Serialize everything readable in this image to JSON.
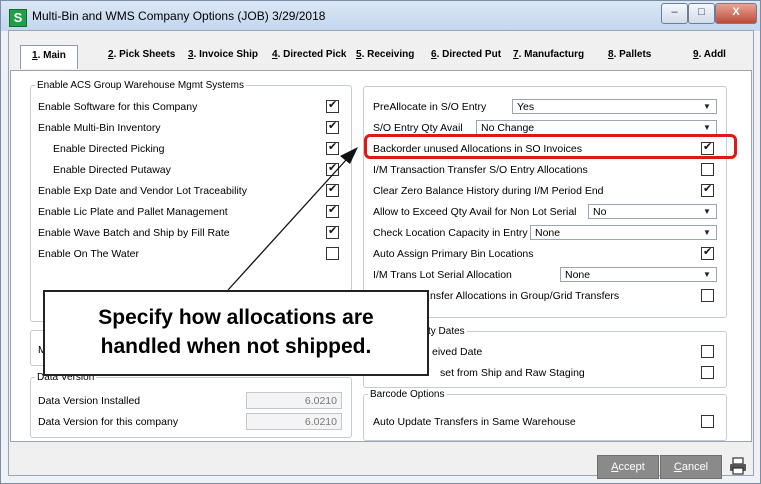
{
  "window": {
    "title": "Multi-Bin and WMS Company Options (JOB) 3/29/2018",
    "app_icon_letter": "S",
    "min_glyph": "–",
    "max_glyph": "□",
    "close_glyph": "X"
  },
  "tabs": [
    {
      "num": "1",
      "label": ". Main"
    },
    {
      "num": "2",
      "label": ". Pick Sheets"
    },
    {
      "num": "3",
      "label": ". Invoice Ship"
    },
    {
      "num": "4",
      "label": ". Directed Pick"
    },
    {
      "num": "5",
      "label": ". Receiving"
    },
    {
      "num": "6",
      "label": ". Directed Put"
    },
    {
      "num": "7",
      "label": ". Manufacturg"
    },
    {
      "num": "8",
      "label": ". Pallets"
    },
    {
      "num": "9",
      "label": ". Addl"
    }
  ],
  "left_group": {
    "legend": "Enable ACS Group Warehouse Mgmt Systems",
    "items": [
      {
        "label": "Enable Software for this Company",
        "checked": true
      },
      {
        "label": "Enable Multi-Bin Inventory",
        "checked": true
      },
      {
        "label": "Enable Directed Picking",
        "checked": true
      },
      {
        "label": "Enable Directed Putaway",
        "checked": true
      },
      {
        "label": "Enable Exp Date and Vendor Lot Traceability",
        "checked": true
      },
      {
        "label": "Enable Lic Plate and Pallet Management",
        "checked": true
      },
      {
        "label": "Enable Wave Batch and Ship by Fill Rate",
        "checked": true
      },
      {
        "label": "Enable On The Water",
        "checked": false
      }
    ]
  },
  "right_group": {
    "rows": [
      {
        "label": "PreAllocate in S/O Entry",
        "combo": "Yes"
      },
      {
        "label": "S/O Entry Qty Avail",
        "combo": "No Change"
      },
      {
        "label": "Backorder unused Allocations in SO Invoices",
        "checked": true
      },
      {
        "label": "I/M Transaction Transfer S/O Entry Allocations",
        "checked": false
      },
      {
        "label": "Clear Zero Balance History during I/M Period End",
        "checked": true
      },
      {
        "label": "Allow to Exceed Qty Avail for Non Lot Serial",
        "combo": "No"
      },
      {
        "label": "Check Location Capacity in Entry",
        "combo": "None"
      },
      {
        "label": "Auto Assign Primary Bin Locations",
        "checked": true
      },
      {
        "label": "I/M Trans Lot Serial Allocation",
        "combo": "None"
      },
      {
        "label": "nsfer Allocations in Group/Grid Transfers",
        "checked": false
      }
    ]
  },
  "dates_group": {
    "legend_partial": "ty Dates",
    "rows": [
      {
        "label": "eived Date",
        "checked": false
      },
      {
        "label": "set from Ship and Raw Staging",
        "checked": false
      }
    ]
  },
  "left_partial_letter": "M",
  "data_version": {
    "legend": "Data Version",
    "installed_label": "Data Version Installed",
    "installed_value": "6.0210",
    "company_label": "Data Version for this company",
    "company_value": "6.0210"
  },
  "barcode": {
    "legend": "Barcode Options",
    "row_label": "Auto Update Transfers in Same Warehouse",
    "checked": false
  },
  "callout": {
    "line1": "Specify how allocations are",
    "line2": "handled when not shipped."
  },
  "buttons": {
    "accept_key": "A",
    "accept_rest": "ccept",
    "cancel_key": "C",
    "cancel_rest": "ancel"
  },
  "colors": {
    "highlight": "#e01818",
    "app_icon": "#21a04a",
    "button_bg": "#8a8a8a"
  },
  "icons": {
    "print": "printer-icon",
    "app": "sage-app-icon"
  }
}
